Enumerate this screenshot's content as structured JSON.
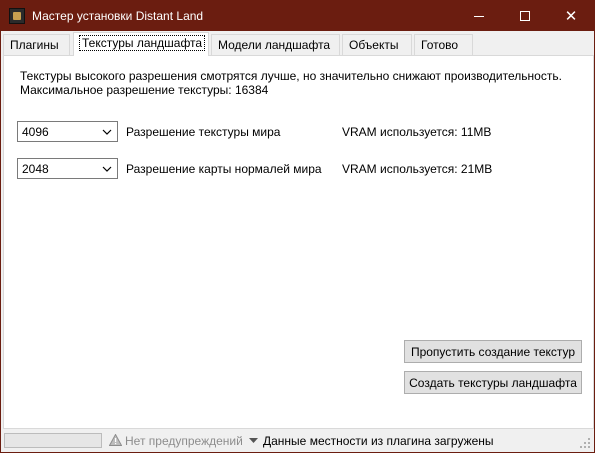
{
  "window": {
    "title": "Мастер установки Distant Land",
    "minimize_symbol": "",
    "maximize_symbol": "",
    "close_symbol": "✕"
  },
  "tabs": [
    {
      "label": "Плагины",
      "active": false
    },
    {
      "label": "Текстуры ландшафта",
      "active": true
    },
    {
      "label": "Модели ландшафта",
      "active": false
    },
    {
      "label": "Объекты",
      "active": false
    },
    {
      "label": "Готово",
      "active": false
    }
  ],
  "main": {
    "description_line1": "Текстуры высокого разрешения смотрятся лучше, но значительно снижают производительность.",
    "description_line2": "Максимальное разрешение текстуры:  16384",
    "world_texture": {
      "value": "4096",
      "label": "Разрешение текстуры мира",
      "vram": "VRAM используется: 11MB"
    },
    "normal_map": {
      "value": "2048",
      "label": "Разрешение карты нормалей мира",
      "vram": "VRAM используется: 21MB"
    },
    "skip_button": "Пропустить создание текстур",
    "create_button": "Создать текстуры ландшафта"
  },
  "statusbar": {
    "progress_fraction": 0,
    "warnings": "Нет предупреждений",
    "status": "Данные местности из плагина загружены"
  },
  "icons": {
    "app": "distant-land-app-icon",
    "warning": "warning-triangle-icon",
    "dropdown": "chevron-down-icon"
  },
  "colors": {
    "titlebar": "#6b1d10",
    "warning_text": "#8d8d8d"
  }
}
